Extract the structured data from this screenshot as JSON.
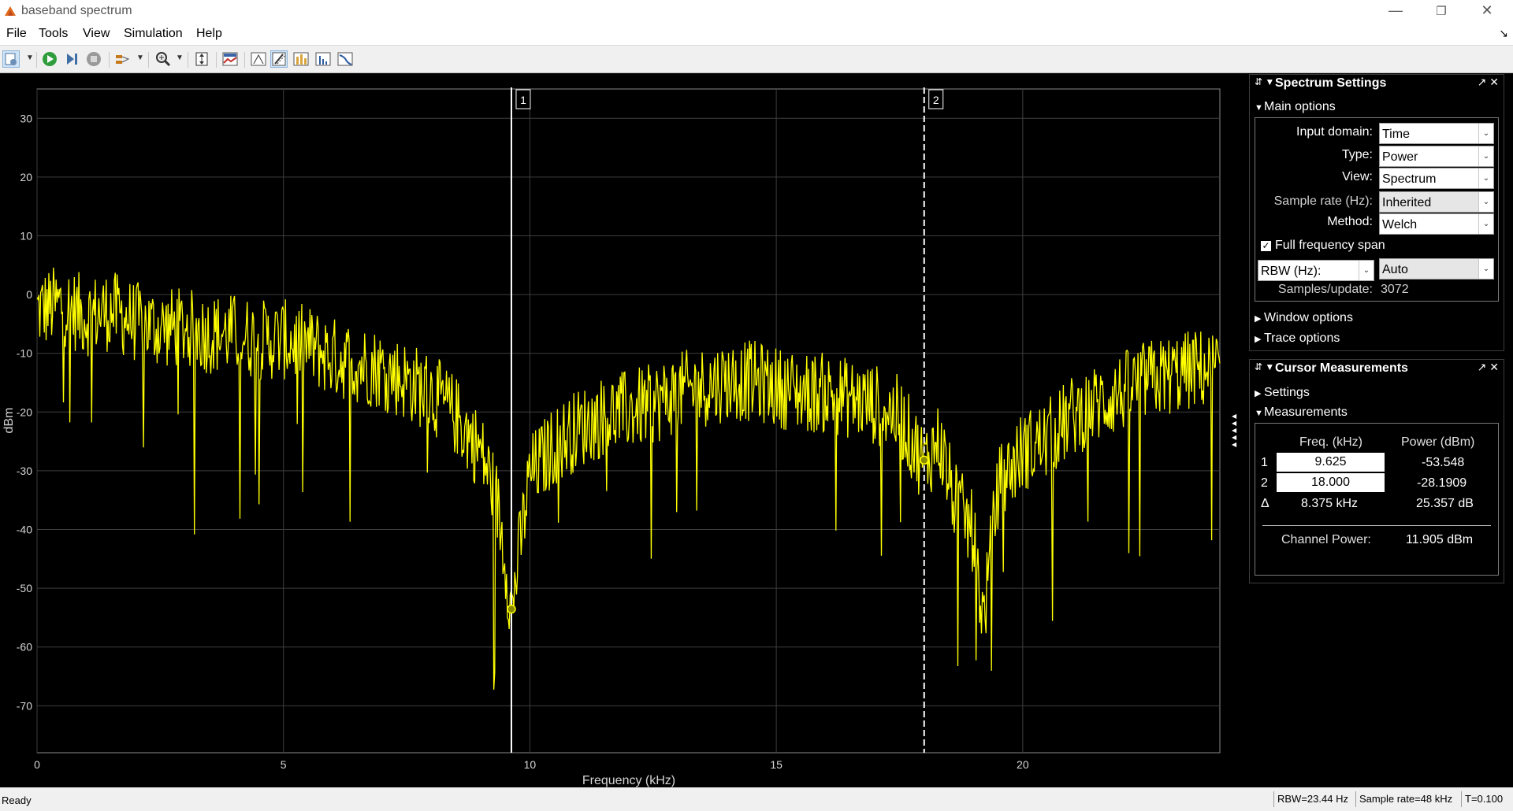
{
  "window": {
    "title": "baseband spectrum"
  },
  "menu": [
    "File",
    "Tools",
    "View",
    "Simulation",
    "Help"
  ],
  "toolbar_icons": [
    "configuration-icon",
    "run-icon",
    "step-forward-icon",
    "stop-icon",
    "signal-select-icon",
    "zoom-in-icon",
    "autoscale-icon",
    "style-icon",
    "data-cursors-icon",
    "cursor-measurements-icon",
    "peak-finder-icon",
    "distortion-measurements-icon",
    "ccdf-icon"
  ],
  "chart_data": {
    "type": "line",
    "xlabel": "Frequency (kHz)",
    "ylabel": "dBm",
    "xlim": [
      0,
      24
    ],
    "ylim": [
      -78,
      35
    ],
    "xticks": [
      0,
      5,
      10,
      15,
      20
    ],
    "yticks": [
      30,
      20,
      10,
      0,
      -10,
      -20,
      -30,
      -40,
      -50,
      -60,
      -70
    ],
    "grid": true,
    "line_color": "#ffff00",
    "series": [
      {
        "x": [
          0,
          0.5,
          1,
          1.5,
          2,
          2.5,
          3,
          3.5,
          4,
          4.5,
          5,
          5.5,
          6,
          6.5,
          7,
          7.5,
          8,
          8.5,
          9,
          9.3,
          9.5,
          9.625,
          9.8,
          10,
          10.5,
          11,
          11.5,
          12,
          12.5,
          13,
          13.5,
          14,
          14.5,
          15,
          15.5,
          16,
          16.5,
          17,
          17.5,
          18,
          18.3,
          18.6,
          19,
          19.2,
          19.5,
          20,
          20.5,
          21,
          21.5,
          22,
          22.5,
          23,
          23.5,
          24
        ],
        "y": [
          -2,
          -1,
          -3,
          -2,
          -4,
          -5,
          -5,
          -6,
          -6,
          -7,
          -7,
          -8,
          -10,
          -11,
          -12,
          -14,
          -16,
          -20,
          -26,
          -33,
          -44,
          -53.5,
          -42,
          -30,
          -25,
          -22,
          -20,
          -19,
          -18,
          -16,
          -15,
          -14,
          -14,
          -15,
          -16,
          -16,
          -17,
          -18,
          -20,
          -28.2,
          -24,
          -34,
          -40,
          -55,
          -32,
          -26,
          -24,
          -20,
          -18,
          -16,
          -14,
          -13,
          -12,
          -12
        ]
      }
    ]
  },
  "cursors": [
    {
      "label": "1",
      "x": 9.625,
      "y": -53.548,
      "style": "solid"
    },
    {
      "label": "2",
      "x": 18.0,
      "y": -28.1909,
      "style": "dashed"
    }
  ],
  "spectrum_settings": {
    "title": "Spectrum Settings",
    "main_options": "Main options",
    "input_domain_label": "Input domain:",
    "input_domain": "Time",
    "type_label": "Type:",
    "type": "Power",
    "view_label": "View:",
    "view": "Spectrum",
    "sample_rate_label": "Sample rate (Hz):",
    "sample_rate": "Inherited",
    "method_label": "Method:",
    "method": "Welch",
    "full_span_label": "Full frequency span",
    "full_span_checked": true,
    "rbw_label": "RBW (Hz):",
    "rbw": "Auto",
    "samples_label": "Samples/update:",
    "samples": "3072",
    "window_options": "Window options",
    "trace_options": "Trace options"
  },
  "cursor_measurements": {
    "title": "Cursor Measurements",
    "settings": "Settings",
    "measurements": "Measurements",
    "freq_header": "Freq. (kHz)",
    "power_header": "Power (dBm)",
    "row1": {
      "idx": "1",
      "freq": "9.625",
      "power": "-53.548"
    },
    "row2": {
      "idx": "2",
      "freq": "18.000",
      "power": "-28.1909"
    },
    "delta": {
      "idx": "Δ",
      "freq": "8.375 kHz",
      "power": "25.357 dB"
    },
    "channel_power_label": "Channel Power:",
    "channel_power": "11.905 dBm"
  },
  "status": {
    "ready": "Ready",
    "rbw": "RBW=23.44 Hz",
    "sample_rate": "Sample rate=48 kHz",
    "time": "T=0.100"
  }
}
